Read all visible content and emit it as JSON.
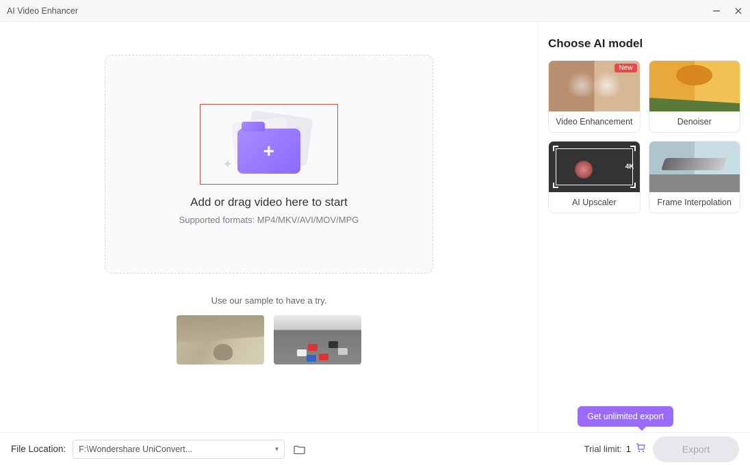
{
  "window": {
    "title": "AI Video Enhancer"
  },
  "dropzone": {
    "headline": "Add or drag video here to start",
    "subline": "Supported formats: MP4/MKV/AVI/MOV/MPG"
  },
  "samples": {
    "label": "Use our sample to have a try."
  },
  "sidebar": {
    "title": "Choose AI model",
    "models": [
      {
        "label": "Video Enhancement",
        "badge": "New"
      },
      {
        "label": "Denoiser"
      },
      {
        "label": "AI Upscaler",
        "res": "4K"
      },
      {
        "label": "Frame Interpolation"
      }
    ]
  },
  "footer": {
    "location_label": "File Location:",
    "location_value": "F:\\Wondershare UniConvert...",
    "trial_label": "Trial limit:",
    "trial_count": "1",
    "bubble": "Get unlimited export",
    "export_label": "Export"
  }
}
